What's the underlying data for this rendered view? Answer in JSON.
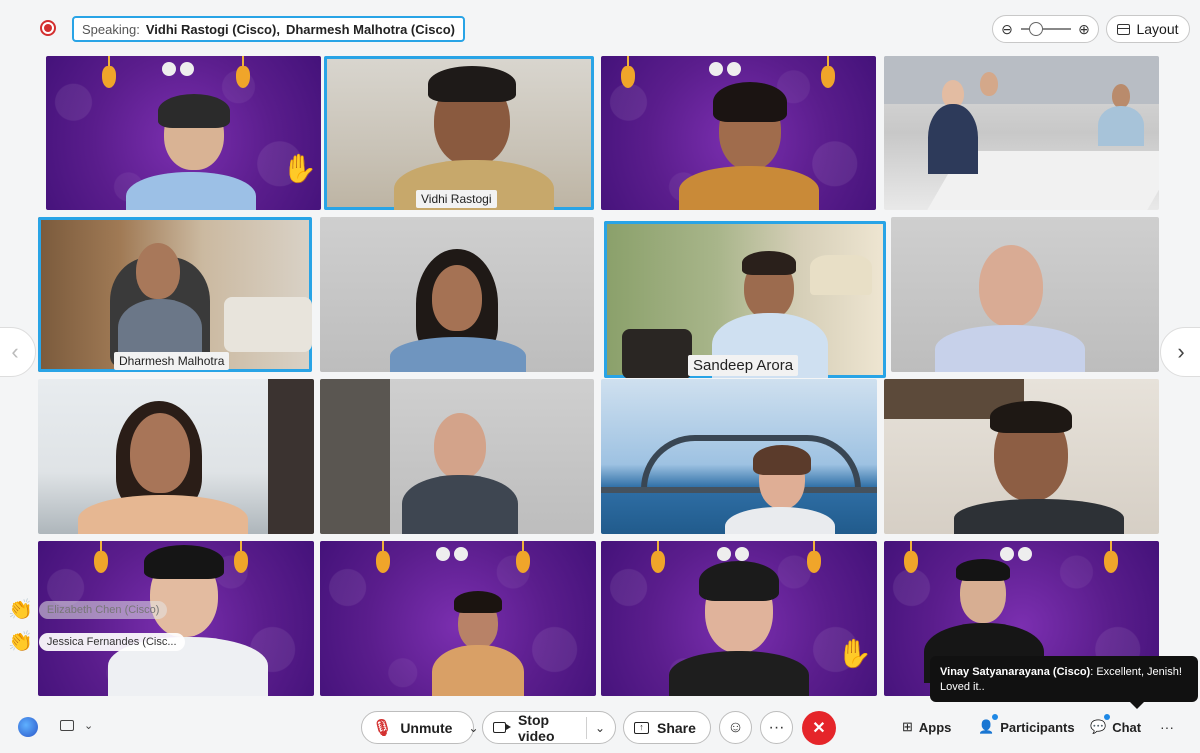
{
  "header": {
    "speaking_label": "Speaking:",
    "speakers": [
      "Vidhi Rastogi (Cisco),",
      "Dharmesh Malhotra (Cisco)"
    ],
    "layout_label": "Layout",
    "zoom_out_icon": "zoom-out-icon",
    "zoom_in_icon": "zoom-in-icon"
  },
  "tiles": [
    {
      "name": "",
      "bg": "purple"
    },
    {
      "name": "Vidhi Rastogi",
      "bg": "room-light",
      "active": true
    },
    {
      "name": "",
      "bg": "purple"
    },
    {
      "name": "",
      "bg": "room-office"
    },
    {
      "name": "Dharmesh Malhotra",
      "bg": "room-wood",
      "active": true
    },
    {
      "name": "",
      "bg": "room-grey"
    },
    {
      "name": "Sandeep Arora",
      "bg": "room-green",
      "active": true
    },
    {
      "name": "",
      "bg": "room-grey"
    },
    {
      "name": "",
      "bg": "room-window"
    },
    {
      "name": "",
      "bg": "room-grey"
    },
    {
      "name": "",
      "bg": "room-sydney"
    },
    {
      "name": "",
      "bg": "room-kitchen"
    },
    {
      "name": "",
      "bg": "purple"
    },
    {
      "name": "",
      "bg": "purple"
    },
    {
      "name": "",
      "bg": "purple"
    },
    {
      "name": "",
      "bg": "purple"
    }
  ],
  "reactions": [
    {
      "emoji": "👏",
      "name": "Elizabeth Chen (Cisco)"
    },
    {
      "emoji": "👏",
      "name": "Jessica Fernandes (Cisc..."
    }
  ],
  "chat_toast": {
    "sender": "Vinay Satyanarayana (Cisco)",
    "message": ": Excellent, Jenish! Loved it.."
  },
  "controls": {
    "unmute": "Unmute",
    "stop_video": "Stop video",
    "share": "Share",
    "apps": "Apps",
    "participants": "Participants",
    "chat": "Chat",
    "more": "···",
    "overflow": "···"
  },
  "colors": {
    "active_border": "#29a4e6",
    "end_call": "#e5252a",
    "mic_off": "#d3302f"
  }
}
